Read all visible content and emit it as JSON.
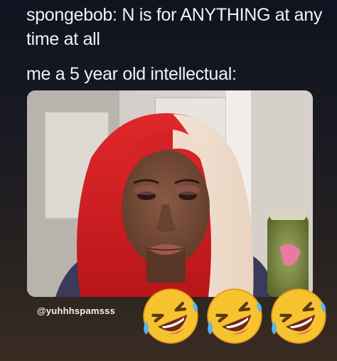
{
  "caption": {
    "line1": "spongebob: N is for ANYTHING at any",
    "line2": "time at all",
    "line3": "me a 5 year old intellectual:"
  },
  "watermark": "@yuhhhspamsss",
  "emojis": [
    "rolling-on-floor-laughing-icon",
    "rolling-on-floor-laughing-icon",
    "rolling-on-floor-laughing-icon"
  ]
}
